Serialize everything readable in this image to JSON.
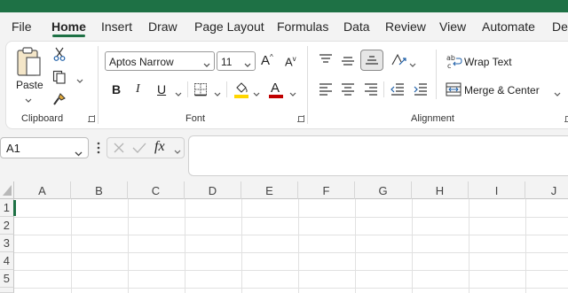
{
  "tabs": [
    {
      "label": "File",
      "active": false
    },
    {
      "label": "Home",
      "active": true
    },
    {
      "label": "Insert",
      "active": false
    },
    {
      "label": "Draw",
      "active": false
    },
    {
      "label": "Page Layout",
      "active": false
    },
    {
      "label": "Formulas",
      "active": false
    },
    {
      "label": "Data",
      "active": false
    },
    {
      "label": "Review",
      "active": false
    },
    {
      "label": "View",
      "active": false
    },
    {
      "label": "Automate",
      "active": false
    },
    {
      "label": "Dev",
      "active": false
    }
  ],
  "ribbon": {
    "clipboard": {
      "label": "Clipboard",
      "paste_label": "Paste"
    },
    "font": {
      "label": "Font",
      "font_name": "Aptos Narrow",
      "font_size": "11",
      "bold": "B",
      "italic": "I",
      "underline": "U",
      "grow": "A",
      "shrink": "A",
      "font_color_letter": "A"
    },
    "alignment": {
      "label": "Alignment",
      "wrap_text": "Wrap Text",
      "merge_center": "Merge & Center"
    }
  },
  "formula_bar": {
    "name_box": "A1",
    "fx": "fx",
    "formula": ""
  },
  "sheet": {
    "columns": [
      "A",
      "B",
      "C",
      "D",
      "E",
      "F",
      "G",
      "H",
      "I",
      "J"
    ],
    "rows": [
      "1",
      "2",
      "3",
      "4",
      "5"
    ],
    "active_cell": "A1"
  },
  "colors": {
    "accent": "#1e7145",
    "highlight": "#ffd600",
    "font_color": "#c00000"
  }
}
